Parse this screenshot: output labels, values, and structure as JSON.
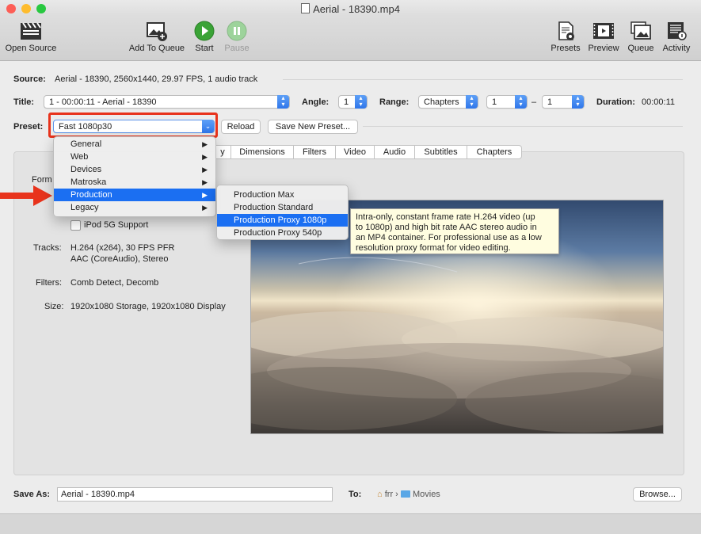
{
  "window": {
    "title": "Aerial - 18390.mp4"
  },
  "toolbar": {
    "open_source": "Open Source",
    "add_to_queue": "Add To Queue",
    "start": "Start",
    "pause": "Pause",
    "presets": "Presets",
    "preview": "Preview",
    "queue": "Queue",
    "activity": "Activity"
  },
  "source": {
    "label": "Source:",
    "value": "Aerial - 18390, 2560x1440, 29.97 FPS, 1 audio track"
  },
  "title_row": {
    "label": "Title:",
    "value": "1 - 00:00:11 - Aerial - 18390",
    "angle_label": "Angle:",
    "angle": "1",
    "range_label": "Range:",
    "range_mode": "Chapters",
    "range_start": "1",
    "range_dash": "–",
    "range_end": "1",
    "duration_label": "Duration:",
    "duration": "00:00:11"
  },
  "preset_row": {
    "label": "Preset:",
    "value": "Fast 1080p30",
    "reload": "Reload",
    "save_new": "Save New Preset..."
  },
  "tabs": [
    "y",
    "Dimensions",
    "Filters",
    "Video",
    "Audio",
    "Subtitles",
    "Chapters"
  ],
  "summary": {
    "format_label": "Form",
    "ipod": "iPod 5G Support",
    "tracks_label": "Tracks:",
    "tracks_line1": "H.264 (x264), 30 FPS PFR",
    "tracks_line2": "AAC (CoreAudio), Stereo",
    "filters_label": "Filters:",
    "filters_value": "Comb Detect, Decomb",
    "size_label": "Size:",
    "size_value": "1920x1080 Storage, 1920x1080 Display"
  },
  "preset_menu": {
    "items": [
      "General",
      "Web",
      "Devices",
      "Matroska",
      "Production",
      "Legacy"
    ],
    "selected": "Production"
  },
  "production_submenu": {
    "items": [
      "Production Max",
      "Production Standard",
      "Production Proxy 1080p",
      "Production Proxy 540p"
    ],
    "selected": "Production Proxy 1080p"
  },
  "tooltip": {
    "line1": "Intra-only, constant frame rate H.264 video (up",
    "line2": "to 1080p) and high bit rate AAC stereo audio in",
    "line3": "an MP4 container. For professional use as a low",
    "line4": "resolution proxy format for video editing."
  },
  "save": {
    "label": "Save As:",
    "filename": "Aerial - 18390.mp4",
    "to_label": "To:",
    "path_user": "frr",
    "path_sep": "›",
    "path_folder": "Movies",
    "browse": "Browse..."
  },
  "colors": {
    "accent": "#1b6ff2",
    "highlight_box": "#e8331c",
    "start_green": "#3aa336"
  }
}
